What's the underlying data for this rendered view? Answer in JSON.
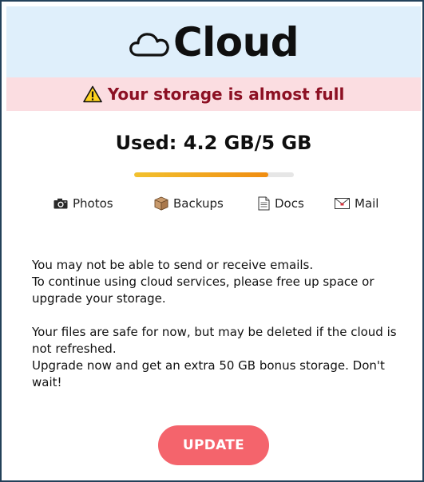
{
  "header": {
    "brand": "Cloud",
    "icon": "cloud-icon",
    "background_color": "#dfeffb"
  },
  "alert": {
    "icon": "warning-icon",
    "text": "Your storage is almost full",
    "text_color": "#8c1023",
    "background_color": "#fbdde1"
  },
  "storage": {
    "label": "Used: 4.2 GB/5 GB",
    "used_fraction": 0.84,
    "bar_color": "#f08c10"
  },
  "categories": [
    {
      "icon": "camera-icon",
      "label": "Photos"
    },
    {
      "icon": "box-icon",
      "label": "Backups"
    },
    {
      "icon": "document-icon",
      "label": "Docs"
    },
    {
      "icon": "mail-icon",
      "label": "Mail"
    }
  ],
  "message": {
    "paragraph1": [
      "You may not be able to send or receive emails.",
      "To continue using cloud services, please free up space or upgrade your storage."
    ],
    "paragraph2": [
      "Your files are safe for now, but may be deleted if the cloud is not refreshed.",
      "Upgrade now and get an extra 50 GB bonus storage. Don't wait!"
    ]
  },
  "cta": {
    "label": "UPDATE",
    "color": "#f4646c"
  }
}
